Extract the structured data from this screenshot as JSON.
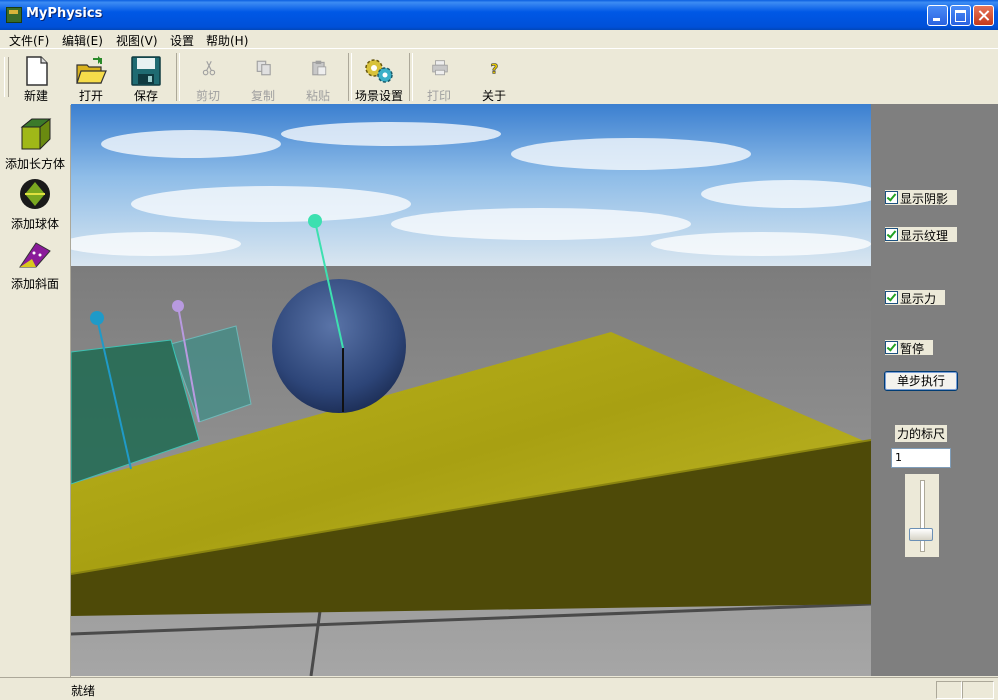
{
  "window": {
    "title": "MyPhysics"
  },
  "menu": {
    "items": [
      "文件(F)",
      "编辑(E)",
      "视图(V)",
      "设置",
      "帮助(H)"
    ]
  },
  "toolbar": {
    "new": "新建",
    "open": "打开",
    "save": "保存",
    "cut": "剪切",
    "copy": "复制",
    "paste": "粘贴",
    "scene_settings": "场景设置",
    "print": "打印",
    "about": "关于"
  },
  "left_panel": {
    "add_box": "添加长方体",
    "add_sphere": "添加球体",
    "add_ramp": "添加斜面"
  },
  "right_panel": {
    "show_shadow": "显示阴影",
    "show_texture": "显示纹理",
    "show_force": "显示力",
    "pause": "暂停",
    "step": "单步执行",
    "force_scale_label": "力的标尺",
    "force_scale_value": "1",
    "slider_level": 0.75
  },
  "status": {
    "text": "就绪"
  },
  "colors": {
    "titlebar": "#0054e3",
    "viewport_bg": "#7f7f7f",
    "yellow_plate": "#b0a818"
  }
}
